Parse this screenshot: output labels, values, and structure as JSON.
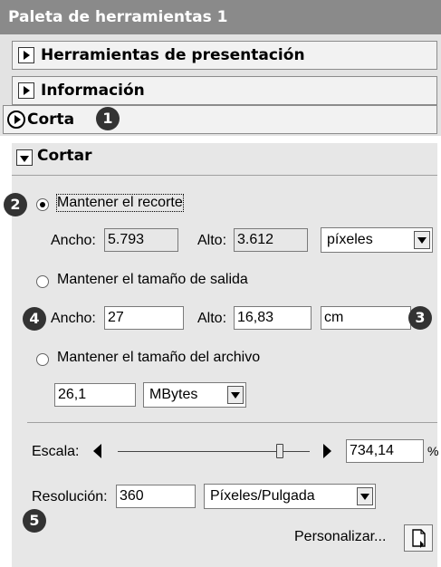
{
  "palette": {
    "title": "Paleta de herramientas 1",
    "sections": [
      {
        "label": "Herramientas de presentación"
      },
      {
        "label": "Información"
      },
      {
        "label": "Corta"
      }
    ]
  },
  "badges": [
    "1",
    "2",
    "3",
    "4",
    "5"
  ],
  "crop": {
    "header": "Cortar",
    "keep_crop": {
      "label": "Mantener el recorte",
      "width_label": "Ancho:",
      "width_value": "5.793",
      "height_label": "Alto:",
      "height_value": "3.612",
      "unit": "píxeles"
    },
    "keep_output": {
      "label": "Mantener el tamaño de salida",
      "width_label": "Ancho:",
      "width_value": "27",
      "height_label": "Alto:",
      "height_value": "16,83",
      "unit": "cm"
    },
    "keep_file": {
      "label": "Mantener el tamaño del archivo",
      "size_value": "26,1",
      "unit": "MBytes"
    },
    "scale": {
      "label": "Escala:",
      "value": "734,14",
      "percent": "%"
    },
    "resolution": {
      "label": "Resolución:",
      "value": "360",
      "unit": "Píxeles/Pulgada"
    },
    "customize_label": "Personalizar..."
  }
}
